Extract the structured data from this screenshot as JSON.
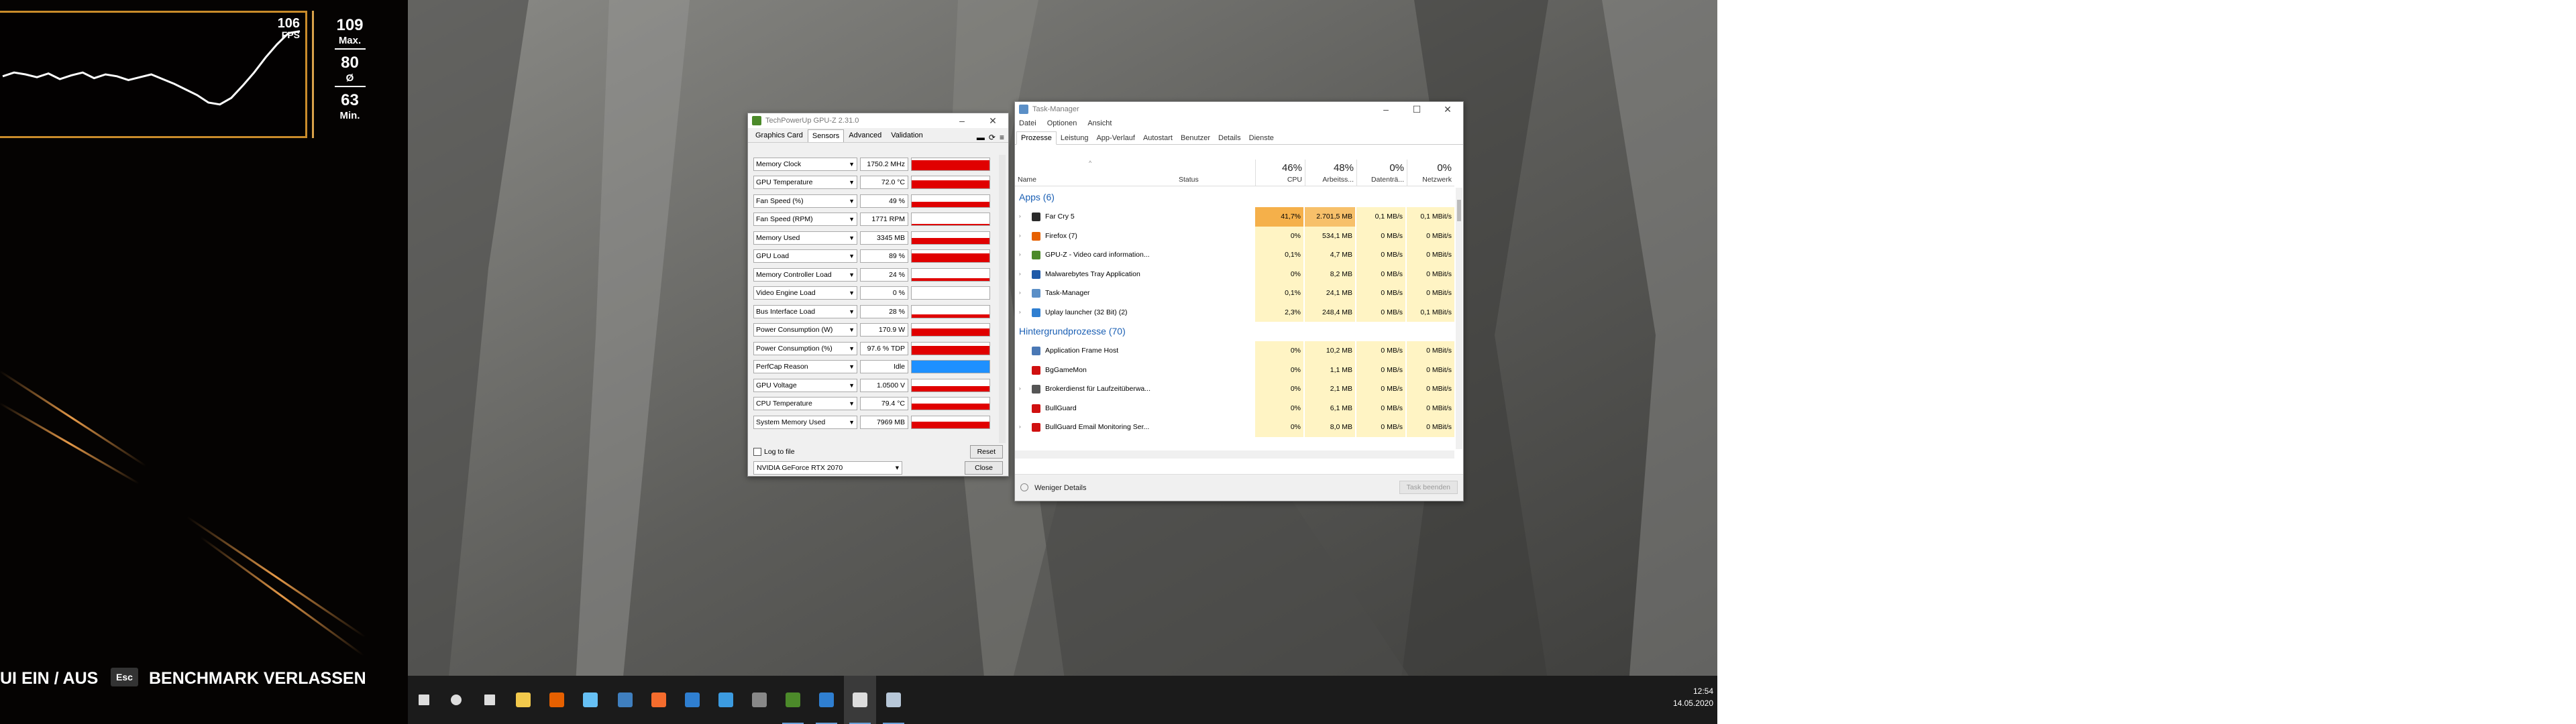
{
  "game": {
    "fps_current": "106",
    "fps_unit": "FPS",
    "max_value": "109",
    "max_label": "Max.",
    "avg_value": "80",
    "avg_symbol": "Ø",
    "min_value": "63",
    "min_label": "Min.",
    "fps_history": [
      58,
      62,
      60,
      57,
      61,
      55,
      59,
      62,
      56,
      60,
      58,
      54,
      57,
      60,
      55,
      50,
      44,
      38,
      30,
      28,
      35,
      48,
      62,
      78,
      92,
      104,
      106
    ],
    "hud_left": "UI EIN / AUS",
    "esc_key": "Esc",
    "hud_right": "BENCHMARK VERLASSEN"
  },
  "gpuz": {
    "title": "TechPowerUp GPU-Z 2.31.0",
    "tabs": [
      "Graphics Card",
      "Sensors",
      "Advanced",
      "Validation"
    ],
    "active_tab": "Sensors",
    "sensors": [
      {
        "name": "Memory Clock",
        "value": "1750.2 MHz",
        "level": 0.8
      },
      {
        "name": "GPU Temperature",
        "value": "72.0 °C",
        "level": 0.7
      },
      {
        "name": "Fan Speed (%)",
        "value": "49 %",
        "level": 0.45
      },
      {
        "name": "Fan Speed (RPM)",
        "value": "1771 RPM",
        "level": 0.15
      },
      {
        "name": "Memory Used",
        "value": "3345 MB",
        "level": 0.5
      },
      {
        "name": "GPU Load",
        "value": "89 %",
        "level": 0.75
      },
      {
        "name": "Memory Controller Load",
        "value": "24 %",
        "level": 0.2
      },
      {
        "name": "Video Engine Load",
        "value": "0 %",
        "level": 0.0
      },
      {
        "name": "Bus Interface Load",
        "value": "28 %",
        "level": 0.25
      },
      {
        "name": "Power Consumption (W)",
        "value": "170.9 W",
        "level": 0.6
      },
      {
        "name": "Power Consumption (%)",
        "value": "97.6 % TDP",
        "level": 0.7
      },
      {
        "name": "PerfCap Reason",
        "value": "Idle",
        "level": 1.0
      },
      {
        "name": "GPU Voltage",
        "value": "1.0500 V",
        "level": 0.45
      },
      {
        "name": "CPU Temperature",
        "value": "79.4 °C",
        "level": 0.5
      },
      {
        "name": "System Memory Used",
        "value": "7969 MB",
        "level": 0.55
      }
    ],
    "log_label": "Log to file",
    "reset_label": "Reset",
    "gpu_select": "NVIDIA GeForce RTX 2070",
    "close_label": "Close"
  },
  "taskmgr": {
    "title": "Task-Manager",
    "menu": [
      "Datei",
      "Optionen",
      "Ansicht"
    ],
    "tabs": [
      "Prozesse",
      "Leistung",
      "App-Verlauf",
      "Autostart",
      "Benutzer",
      "Details",
      "Dienste"
    ],
    "active_tab": "Prozesse",
    "col_name": "Name",
    "col_status": "Status",
    "cpu_pct": "46%",
    "cpu_label": "CPU",
    "mem_pct": "48%",
    "mem_label": "Arbeitss...",
    "disk_pct": "0%",
    "disk_label": "Datenträ...",
    "net_pct": "0%",
    "net_label": "Netzwerk",
    "apps_header": "Apps (6)",
    "apps": [
      {
        "name": "Far Cry 5",
        "cpu": "41,7%",
        "mem": "2.701,5 MB",
        "disk": "0,1 MB/s",
        "net": "0,1 MBit/s",
        "icon_color": "#2b2b2b",
        "hot": true
      },
      {
        "name": "Firefox (7)",
        "cpu": "0%",
        "mem": "534,1 MB",
        "disk": "0 MB/s",
        "net": "0 MBit/s",
        "icon_color": "#e66000",
        "hot": false
      },
      {
        "name": "GPU-Z - Video card information...",
        "cpu": "0,1%",
        "mem": "4,7 MB",
        "disk": "0 MB/s",
        "net": "0 MBit/s",
        "icon_color": "#4c8a2a",
        "hot": false
      },
      {
        "name": "Malwarebytes Tray Application",
        "cpu": "0%",
        "mem": "8,2 MB",
        "disk": "0 MB/s",
        "net": "0 MBit/s",
        "icon_color": "#1f5aa8",
        "hot": false
      },
      {
        "name": "Task-Manager",
        "cpu": "0,1%",
        "mem": "24,1 MB",
        "disk": "0 MB/s",
        "net": "0 MBit/s",
        "icon_color": "#5b8fc7",
        "hot": false
      },
      {
        "name": "Uplay launcher (32 Bit) (2)",
        "cpu": "2,3%",
        "mem": "248,4 MB",
        "disk": "0 MB/s",
        "net": "0,1 MBit/s",
        "icon_color": "#2f7fd1",
        "hot": false
      }
    ],
    "bg_header": "Hintergrundprozesse (70)",
    "bg": [
      {
        "name": "Application Frame Host",
        "cpu": "0%",
        "mem": "10,2 MB",
        "disk": "0 MB/s",
        "net": "0 MBit/s",
        "icon_color": "#4a78b5",
        "expand": false
      },
      {
        "name": "BgGameMon",
        "cpu": "0%",
        "mem": "1,1 MB",
        "disk": "0 MB/s",
        "net": "0 MBit/s",
        "icon_color": "#d01010",
        "expand": false
      },
      {
        "name": "Brokerdienst für Laufzeitüberwa...",
        "cpu": "0%",
        "mem": "2,1 MB",
        "disk": "0 MB/s",
        "net": "0 MBit/s",
        "icon_color": "#555555",
        "expand": true
      },
      {
        "name": "BullGuard",
        "cpu": "0%",
        "mem": "6,1 MB",
        "disk": "0 MB/s",
        "net": "0 MBit/s",
        "icon_color": "#d01010",
        "expand": false
      },
      {
        "name": "BullGuard Email Monitoring Ser...",
        "cpu": "0%",
        "mem": "8,0 MB",
        "disk": "0 MB/s",
        "net": "0 MBit/s",
        "icon_color": "#d01010",
        "expand": true
      }
    ],
    "less_details": "Weniger Details",
    "end_task": "Task beenden"
  },
  "taskbar": {
    "icons": [
      {
        "name": "start-icon",
        "color": "#ffffff"
      },
      {
        "name": "search-icon",
        "color": "#ffffff"
      },
      {
        "name": "task-view-icon",
        "color": "#ffffff"
      },
      {
        "name": "explorer-icon",
        "color": "#f2c94c"
      },
      {
        "name": "firefox-icon",
        "color": "#e66000"
      },
      {
        "name": "steam-icon",
        "color": "#66c0f4"
      },
      {
        "name": "app-icon",
        "color": "#3f7fbf"
      },
      {
        "name": "origin-icon",
        "color": "#f56c2d"
      },
      {
        "name": "uplay-icon",
        "color": "#2f7fd1"
      },
      {
        "name": "edge-icon",
        "color": "#3c9be0"
      },
      {
        "name": "terminal-icon",
        "color": "#888888"
      },
      {
        "name": "gpuz-icon",
        "color": "#4c8a2a"
      },
      {
        "name": "uplay-running-icon",
        "color": "#2f7fd1"
      },
      {
        "name": "farcry-icon",
        "color": "#dddddd"
      },
      {
        "name": "taskmgr-icon",
        "color": "#b7c7d8"
      }
    ],
    "time": "12:54",
    "date": "14.05.2020"
  }
}
